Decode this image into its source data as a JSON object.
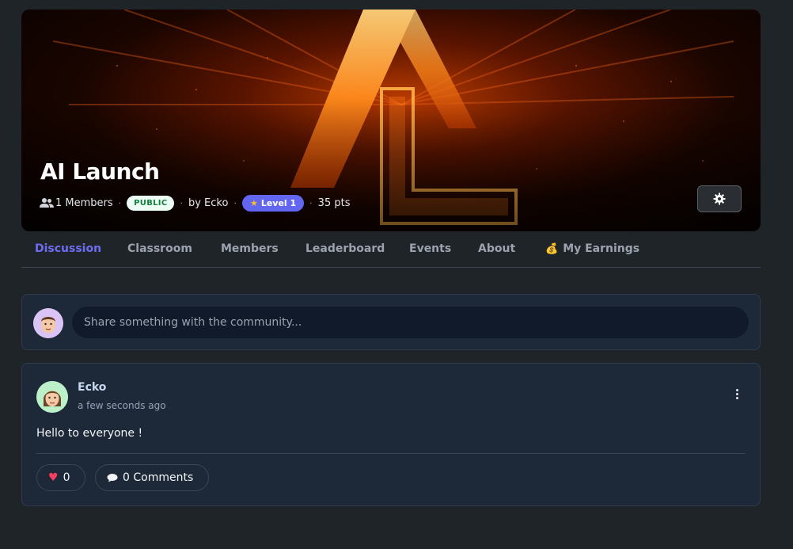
{
  "community": {
    "title": "AI Launch",
    "members_label": "1 Members",
    "visibility": "PUBLIC",
    "owner_label": "by Ecko",
    "level_label": "Level 1",
    "points_label": "35 pts"
  },
  "tabs": [
    {
      "label": "Discussion",
      "active": true
    },
    {
      "label": "Classroom"
    },
    {
      "label": "Members"
    },
    {
      "label": "Leaderboard"
    },
    {
      "label": "Events"
    },
    {
      "label": "About"
    },
    {
      "label": "My Earnings",
      "icon": "money-bag-icon"
    }
  ],
  "composer": {
    "placeholder": "Share something with the community..."
  },
  "post": {
    "author": "Ecko",
    "time": "a few seconds ago",
    "text": "Hello to everyone !",
    "likes": "0",
    "comments_label": "0 Comments"
  },
  "colors": {
    "accent": "#6366f1",
    "active_tab": "#6f6cf0",
    "page_bg": "#1f2429",
    "card_bg": "#1d2939",
    "heart": "#f43f5e"
  }
}
